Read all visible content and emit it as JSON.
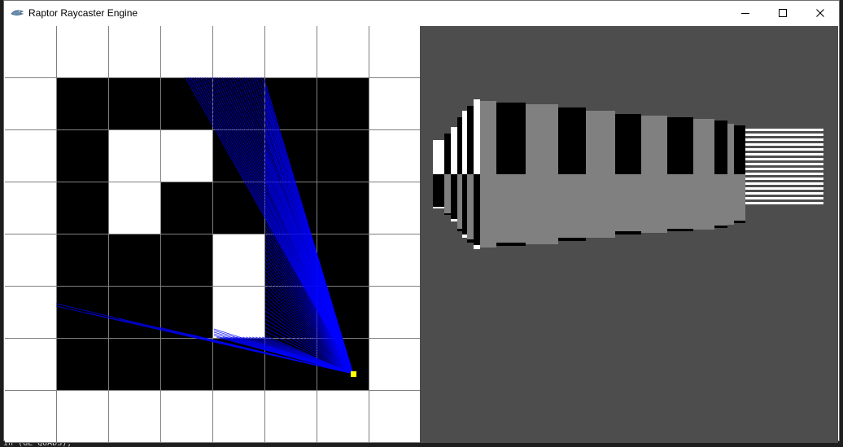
{
  "window": {
    "title": "Raptor Raycaster Engine",
    "icon": "raptor-app-icon",
    "controls": [
      "minimize-icon",
      "maximize-icon",
      "close-icon"
    ]
  },
  "background_terminal": {
    "bottom_text": "in (GL_QUADS);"
  },
  "map": {
    "grid": [
      [
        1,
        1,
        1,
        1,
        1,
        1,
        1,
        1
      ],
      [
        1,
        0,
        0,
        0,
        0,
        0,
        0,
        1
      ],
      [
        1,
        0,
        1,
        1,
        0,
        0,
        0,
        1
      ],
      [
        1,
        0,
        1,
        0,
        0,
        0,
        0,
        1
      ],
      [
        1,
        0,
        0,
        0,
        1,
        0,
        0,
        1
      ],
      [
        1,
        0,
        0,
        0,
        1,
        0,
        0,
        1
      ],
      [
        1,
        0,
        0,
        0,
        0,
        0,
        0,
        1
      ],
      [
        1,
        1,
        1,
        1,
        1,
        1,
        1,
        1
      ]
    ],
    "wall_color": "#ffffff",
    "floor_color": "#000000",
    "grid_line_color": "#808080",
    "ray_color": "#0000ff",
    "player_color": "#ffff00"
  },
  "scene": {
    "background_color": "#4d4d4d",
    "wall_colors": [
      "#000000",
      "#808080",
      "#ffffff"
    ]
  }
}
